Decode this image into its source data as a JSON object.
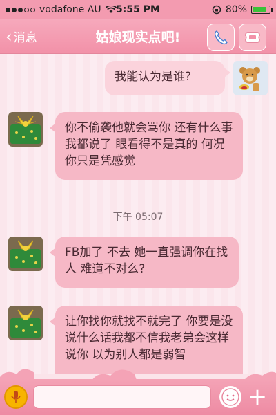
{
  "status": {
    "carrier": "vodafone AU",
    "time": "5:55 PM",
    "battery": "80%",
    "battery_level": 0.8
  },
  "header": {
    "back_label": "消息",
    "title": "姑娘现实点吧!"
  },
  "messages": [
    {
      "side": "out",
      "text": "我能认为是谁?"
    },
    {
      "side": "in",
      "text": "你不偷袭他就会骂你 还有什么事 我都说了 眼看得不是真的  何况你只是凭感觉"
    },
    {
      "side": "time",
      "text": "下午 05:07"
    },
    {
      "side": "in",
      "text": "FB加了 不去 她一直强调你在找人 难道不对么?"
    },
    {
      "side": "in",
      "text": "让你找你就找不就完了  你要是没说什么话我都不信我老弟会这样说你  以为别人都是弱智"
    }
  ],
  "input": {
    "placeholder": ""
  },
  "colors": {
    "accent": "#f291a8",
    "bubble_in": "#f6b8c6",
    "bubble_out": "#fbd3dc"
  }
}
